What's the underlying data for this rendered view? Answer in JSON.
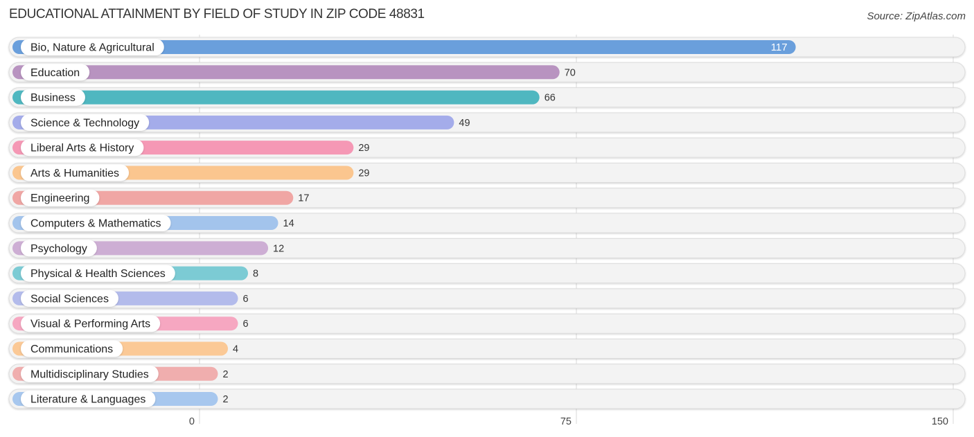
{
  "header": {
    "title": "EDUCATIONAL ATTAINMENT BY FIELD OF STUDY IN ZIP CODE 48831",
    "source": "Source: ZipAtlas.com"
  },
  "chart_data": {
    "type": "bar",
    "orientation": "horizontal",
    "title": "EDUCATIONAL ATTAINMENT BY FIELD OF STUDY IN ZIP CODE 48831",
    "source": "Source: ZipAtlas.com",
    "xlabel": "",
    "ylabel": "",
    "xlim": [
      0,
      150
    ],
    "xticks": [
      0,
      75,
      150
    ],
    "grid": true,
    "categories": [
      "Bio, Nature & Agricultural",
      "Education",
      "Business",
      "Science & Technology",
      "Liberal Arts & History",
      "Arts & Humanities",
      "Engineering",
      "Computers & Mathematics",
      "Psychology",
      "Physical & Health Sciences",
      "Social Sciences",
      "Visual & Performing Arts",
      "Communications",
      "Multidisciplinary Studies",
      "Literature & Languages"
    ],
    "values": [
      117,
      70,
      66,
      49,
      29,
      29,
      17,
      14,
      12,
      8,
      6,
      6,
      4,
      2,
      2
    ],
    "colors": [
      "#6a9fdc",
      "#b893c0",
      "#4fb7c0",
      "#a4acea",
      "#f598b5",
      "#fbc68f",
      "#f0a6a4",
      "#a3c4ec",
      "#cdaed4",
      "#7ccbd4",
      "#b3bbeb",
      "#f6a7c1",
      "#fbc996",
      "#f0aeae",
      "#a7c7ee"
    ]
  }
}
